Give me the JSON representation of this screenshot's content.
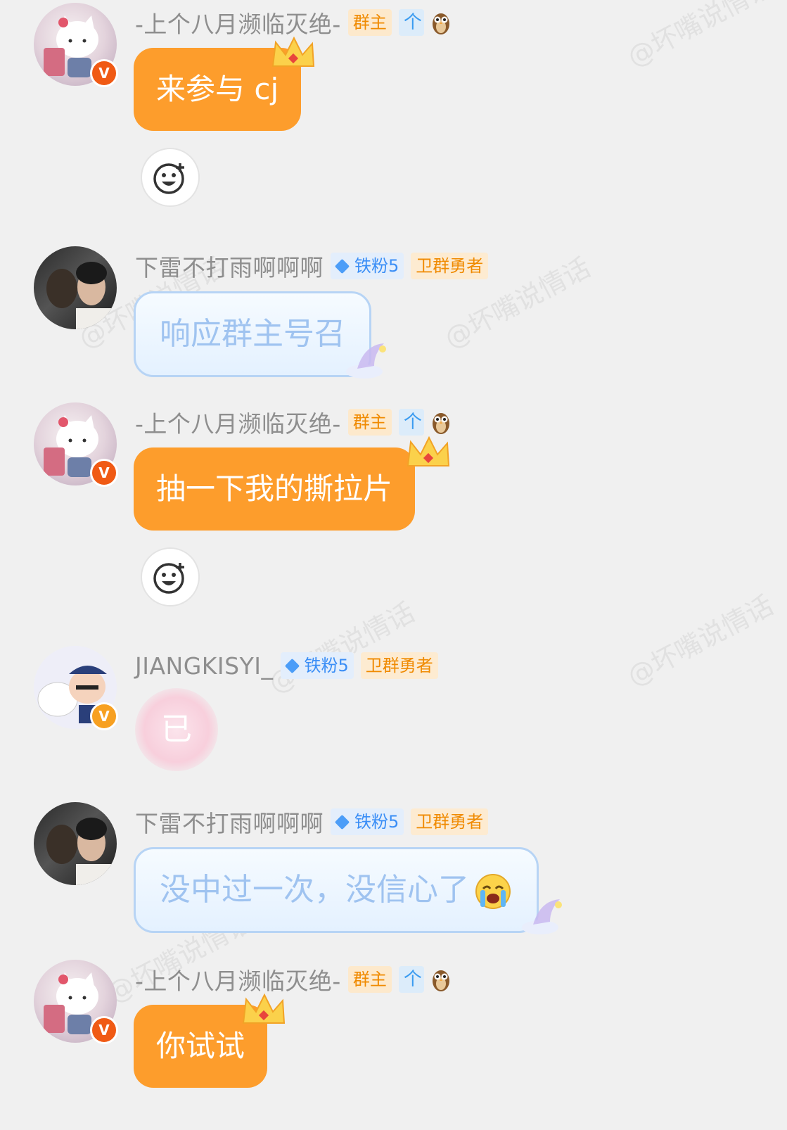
{
  "watermark": "@坏嘴说情话",
  "badges": {
    "owner": "群主",
    "up": "个",
    "fan": "铁粉5",
    "guard": "卫群勇者"
  },
  "messages": [
    {
      "name": "-上个八月濒临灭绝-",
      "text": "来参与 cj"
    },
    {
      "name": "下雷不打雨啊啊啊",
      "text": "响应群主号召"
    },
    {
      "name": "-上个八月濒临灭绝-",
      "text": "抽一下我的撕拉片"
    },
    {
      "name": "JIANGKISYI_",
      "text": "已"
    },
    {
      "name": "下雷不打雨啊啊啊",
      "text": "没中过一次，没信心了"
    },
    {
      "name": "-上个八月濒临灭绝-",
      "text": "你试试"
    }
  ],
  "icons": {
    "verified": "V",
    "add_reaction": "add-reaction-icon",
    "owl": "owl-icon",
    "crown": "crown-icon",
    "crying": "crying-emoji-icon"
  },
  "colors": {
    "owner_bubble": "#fd9d2c",
    "fan_bubble_border": "#b7d4f5",
    "background": "#f0f0f0"
  }
}
